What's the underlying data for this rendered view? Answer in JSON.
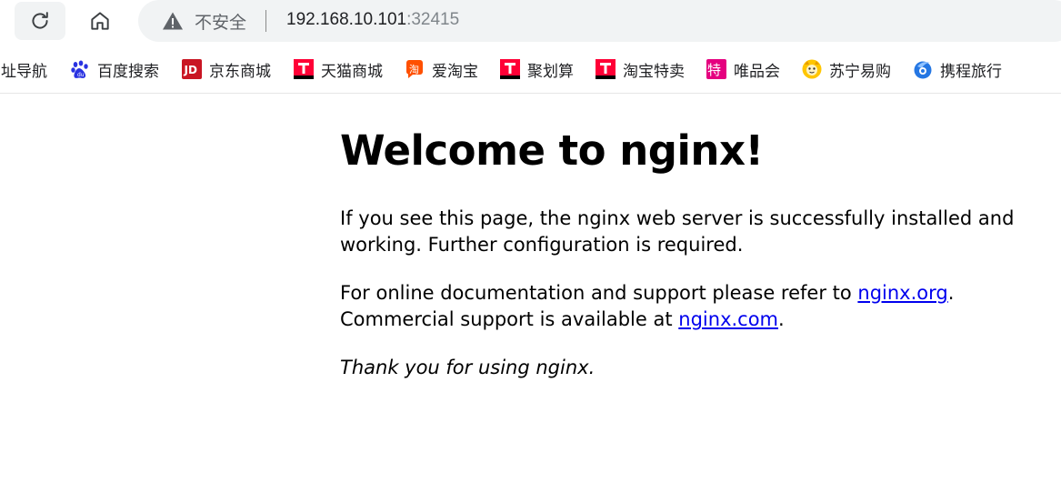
{
  "browser": {
    "security_label": "不安全",
    "url_host": "192.168.10.101",
    "url_port": ":32415",
    "bookmarks": [
      {
        "label": "网址导航",
        "icon": "globe-icon"
      },
      {
        "label": "百度搜索",
        "icon": "baidu-paw-icon",
        "color": "#2932e1"
      },
      {
        "label": "京东商城",
        "icon": "jd-icon",
        "color": "#c91623"
      },
      {
        "label": "天猫商城",
        "icon": "tmall-icon",
        "color": "#ff0036"
      },
      {
        "label": "爱淘宝",
        "icon": "aitaobao-icon",
        "color": "#ff5000"
      },
      {
        "label": "聚划算",
        "icon": "juhuasuan-icon",
        "color": "#ff0036"
      },
      {
        "label": "淘宝特卖",
        "icon": "taobao-temai-icon",
        "color": "#ff0036"
      },
      {
        "label": "唯品会",
        "icon": "vip-icon",
        "color": "#e5007f"
      },
      {
        "label": "苏宁易购",
        "icon": "suning-icon",
        "color": "#ffc600"
      },
      {
        "label": "携程旅行",
        "icon": "ctrip-icon",
        "color": "#2577e3"
      }
    ]
  },
  "page": {
    "heading": "Welcome to nginx!",
    "p1": "If you see this page, the nginx web server is successfully installed and working. Further configuration is required.",
    "p2_before_link1": "For online documentation and support please refer to ",
    "link1": "nginx.org",
    "p2_after_link1": ".",
    "p2_line2_before_link2": "Commercial support is available at ",
    "link2": "nginx.com",
    "p2_after_link2": ".",
    "p3": "Thank you for using nginx."
  }
}
